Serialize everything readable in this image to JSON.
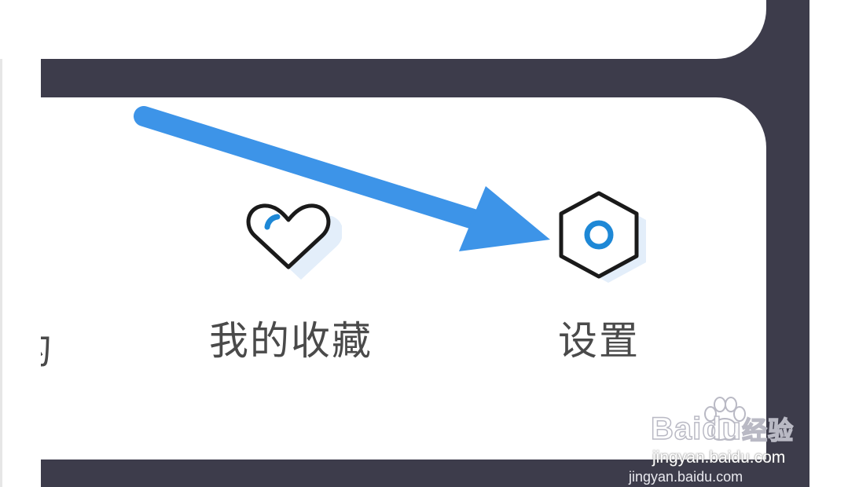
{
  "menu": {
    "partial_label": "的",
    "favorites": {
      "label": "我的收藏",
      "icon": "heart-icon"
    },
    "settings": {
      "label": "设置",
      "icon": "hexagon-settings-icon"
    }
  },
  "annotation": {
    "icon": "arrow-icon",
    "color": "#3d94e8"
  },
  "watermark": {
    "brand": "Baidu",
    "suffix": "经验",
    "url": "jingyan.baidu.com",
    "url_repeat": "jingyan.baidu.com"
  },
  "colors": {
    "frame": "#3d3c4b",
    "card": "#ffffff",
    "text": "#4a4a4a",
    "accent": "#1e88d6"
  }
}
